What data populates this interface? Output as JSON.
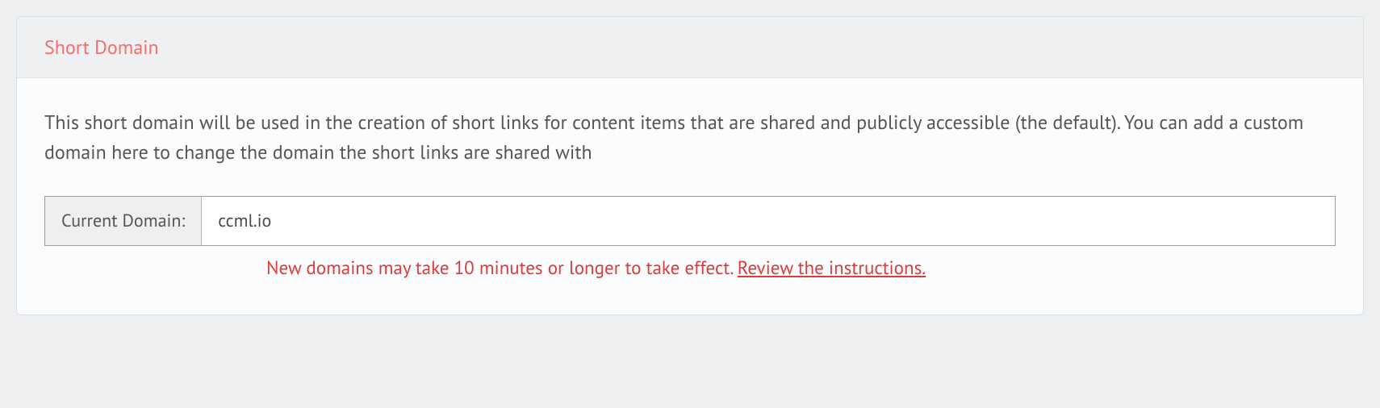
{
  "panel": {
    "title": "Short Domain",
    "description": "This short domain will be used in the creation of short links for content items that are shared and publicly accessible (the default). You can add a custom domain here to change the domain the short links are shared with",
    "input": {
      "label": "Current Domain:",
      "value": "ccml.io"
    },
    "helper": {
      "text": "New domains may take 10 minutes or longer to take effect. ",
      "link_text": "Review the instructions."
    }
  }
}
